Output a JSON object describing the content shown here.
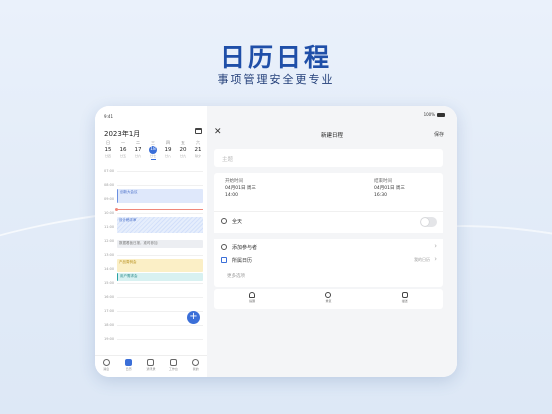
{
  "hero": {
    "title": "日历日程",
    "subtitle": "事项管理安全更专业"
  },
  "status": {
    "time": "9:41",
    "battery": "100%"
  },
  "calendar": {
    "month": "2023年1月",
    "week": [
      {
        "wd": "日",
        "day": "15",
        "lunar": "廿四"
      },
      {
        "wd": "一",
        "day": "16",
        "lunar": "廿五"
      },
      {
        "wd": "二",
        "day": "17",
        "lunar": "廿六"
      },
      {
        "wd": "三",
        "day": "18",
        "lunar": "廿七",
        "selected": true
      },
      {
        "wd": "四",
        "day": "19",
        "lunar": "廿八"
      },
      {
        "wd": "五",
        "day": "20",
        "lunar": "廿九"
      },
      {
        "wd": "六",
        "day": "21",
        "lunar": "除夕"
      }
    ],
    "hours": [
      "07:00",
      "08:00",
      "09:00",
      "10:00",
      "11:00",
      "12:00",
      "13:00",
      "14:00",
      "15:00",
      "16:00",
      "17:00",
      "18:00",
      "19:00"
    ],
    "events": [
      {
        "label": "创新大会议"
      },
      {
        "label": "设计稿评审"
      },
      {
        "label": "数据看板日报，准时参加"
      },
      {
        "label": "产品周例会"
      },
      {
        "label": "用户需求会"
      }
    ],
    "tabs": [
      "消息",
      "日历",
      "通讯录",
      "工作台",
      "我的"
    ]
  },
  "form": {
    "close": "✕",
    "title": "新建日程",
    "save": "保存",
    "subject_placeholder": "主题",
    "start_label": "开始时间",
    "start_date": "04月01日  周三",
    "start_time": "14:00",
    "end_label": "结束时间",
    "end_date": "04月01日  周三",
    "end_time": "16:30",
    "allday": "全天",
    "add_participants": "添加参与者",
    "calendar_label": "所属日历",
    "calendar_value": "我的日历",
    "more": "更多选项",
    "actions": [
      "提醒",
      "重复",
      "描述"
    ]
  }
}
